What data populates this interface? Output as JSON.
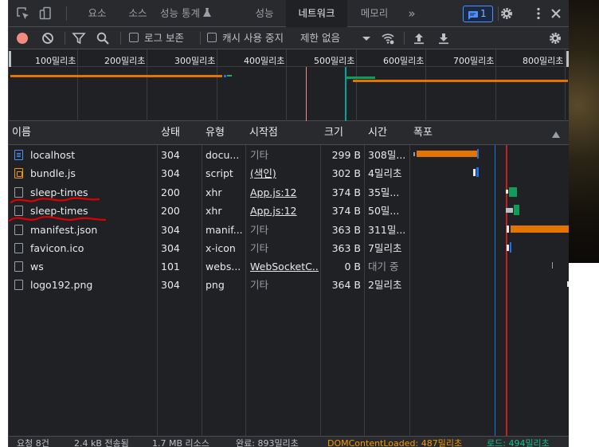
{
  "tabs": [
    {
      "label": "요소"
    },
    {
      "label": "소스"
    },
    {
      "label": "성능 통계"
    },
    {
      "label": "성능"
    },
    {
      "label": "네트워크"
    },
    {
      "label": "메모리"
    }
  ],
  "issues_count": "1",
  "toolbar": {
    "preserve_log_label": "로그 보존",
    "disable_cache_label": "캐시 사용 중지",
    "throttle_label": "제한 없음"
  },
  "overview": {
    "ticks": [
      "100밀리초",
      "200밀리초",
      "300밀리초",
      "400밀리초",
      "500밀리초",
      "600밀리초",
      "700밀리초",
      "800밀리초"
    ]
  },
  "table": {
    "headers": {
      "name": "이름",
      "status": "상태",
      "type": "유형",
      "initiator": "시작점",
      "size": "크기",
      "time": "시간",
      "waterfall": "폭포"
    },
    "rows": [
      {
        "name": "localhost",
        "status": "304",
        "type": "docu...",
        "initiator": "기타",
        "size": "299 B",
        "time": "308밀...",
        "icon": "document-icon"
      },
      {
        "name": "bundle.js",
        "status": "304",
        "type": "script",
        "initiator": "(색인)",
        "size": "302 B",
        "time": "4밀리초",
        "icon": "script-icon"
      },
      {
        "name": "sleep-times",
        "status": "200",
        "type": "xhr",
        "initiator": "App.js:12",
        "size": "374 B",
        "time": "35밀...",
        "icon": "file-icon"
      },
      {
        "name": "sleep-times",
        "status": "200",
        "type": "xhr",
        "initiator": "App.js:12",
        "size": "374 B",
        "time": "50밀...",
        "icon": "file-icon"
      },
      {
        "name": "manifest.json",
        "status": "304",
        "type": "manif...",
        "initiator": "기타",
        "size": "363 B",
        "time": "311밀...",
        "icon": "file-icon"
      },
      {
        "name": "favicon.ico",
        "status": "304",
        "type": "x-icon",
        "initiator": "기타",
        "size": "363 B",
        "time": "7밀리초",
        "icon": "file-icon"
      },
      {
        "name": "ws",
        "status": "101",
        "type": "webs...",
        "initiator": "WebSocketC...",
        "size": "0 B",
        "time": "대기 중",
        "icon": "file-icon"
      },
      {
        "name": "logo192.png",
        "status": "304",
        "type": "png",
        "initiator": "기타",
        "size": "364 B",
        "time": "2밀리초",
        "icon": "file-icon"
      }
    ]
  },
  "statusbar": {
    "requests": "요청 8건",
    "transferred": "2.4 kB 전송됨",
    "resources": "1.7 MB 리소스",
    "finish": "완료: 893밀리초",
    "domcontentloaded": "DOMContentLoaded: 487밀리초",
    "load": "로드: 494밀리초"
  },
  "colors": {
    "accent": "#8ab4f8",
    "waiting_bar": "#e37400",
    "receive_bar": "#1a73e8",
    "xhr_bar": "#0f9d58",
    "record_button": "#f28b82",
    "dom_line": "#4285f4",
    "load_line": "#c5221f"
  }
}
